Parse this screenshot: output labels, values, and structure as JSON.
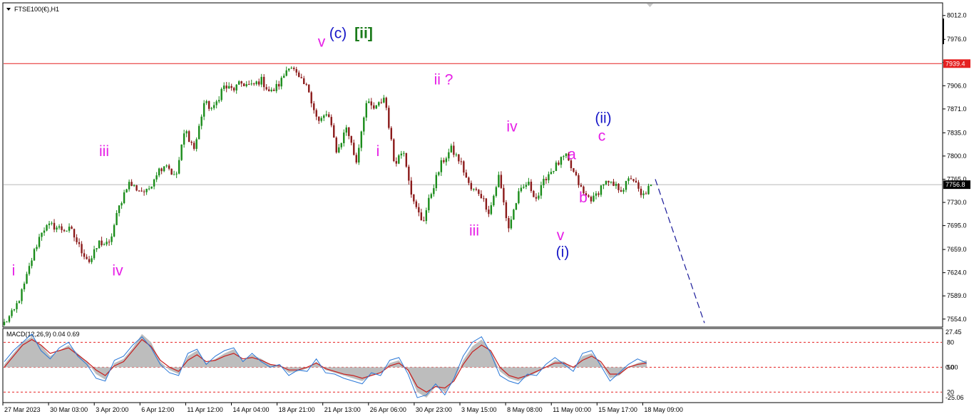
{
  "window": {
    "title": "FTSE100(€),H1"
  },
  "indicator": {
    "title": "MACD(12,26,9) 0.04 0.69"
  },
  "colors": {
    "background": "#ffffff",
    "bull": "#1a8c1a",
    "bear": "#8b1a1a",
    "resistance": "#e52020",
    "current_price_line": "#b8b8b8",
    "projection": "#1a1a9a",
    "macd_hist": "#bdbdbd",
    "macd_signal": "#c81e1e",
    "macd_line": "#2a78d8",
    "label_magenta": "#e61ee6",
    "label_blue": "#1818c8",
    "label_green": "#1a7a1a"
  },
  "chart_data": [
    {
      "type": "candlestick",
      "title": "FTSE100(€),H1",
      "ylim": [
        7543,
        8030
      ],
      "y_ticks": [
        "8012.0",
        "7976.0",
        "7941.0",
        "7906.0",
        "7871.0",
        "7835.0",
        "7800.0",
        "7765.0",
        "7730.0",
        "7695.0",
        "7659.0",
        "7624.0",
        "7589.0",
        "7554.0"
      ],
      "x_ticks": [
        "27 Mar 2023",
        "30 Mar 03:00",
        "3 Apr 20:00",
        "6 Apr 12:00",
        "11 Apr 12:00",
        "14 Apr 04:00",
        "18 Apr 21:00",
        "21 Apr 13:00",
        "26 Apr 06:00",
        "30 Apr 23:00",
        "3 May 15:00",
        "8 May 08:00",
        "11 May 00:00",
        "15 May 17:00",
        "18 May 09:00"
      ],
      "horizontal_lines": [
        {
          "name": "resistance",
          "price": 7939.4,
          "label": "7939.4",
          "color": "#e52020"
        },
        {
          "name": "current-price",
          "price": 7756.8,
          "label": "7756.8",
          "color": "#b8b8b8"
        }
      ],
      "price_path": [
        7548,
        7565,
        7600,
        7650,
        7690,
        7695,
        7690,
        7688,
        7660,
        7640,
        7670,
        7665,
        7720,
        7760,
        7750,
        7745,
        7775,
        7790,
        7765,
        7840,
        7810,
        7880,
        7870,
        7905,
        7900,
        7910,
        7905,
        7915,
        7895,
        7910,
        7940,
        7915,
        7900,
        7850,
        7865,
        7805,
        7845,
        7790,
        7880,
        7870,
        7890,
        7790,
        7810,
        7730,
        7700,
        7750,
        7790,
        7810,
        7790,
        7750,
        7745,
        7715,
        7770,
        7690,
        7740,
        7760,
        7735,
        7770,
        7785,
        7800,
        7770,
        7740,
        7735,
        7760,
        7755,
        7750,
        7770,
        7737,
        7756
      ],
      "projection": {
        "from_price": 7765,
        "to_price": 7548,
        "style": "dashed"
      },
      "wave_labels": [
        {
          "text": "i",
          "price": 7620,
          "color": "magenta"
        },
        {
          "text": "iii",
          "price": 7800,
          "color": "magenta"
        },
        {
          "text": "iv",
          "price": 7620,
          "color": "magenta"
        },
        {
          "text": "v",
          "price": 7965,
          "color": "magenta"
        },
        {
          "text": "(c)",
          "price": 7978,
          "color": "blue"
        },
        {
          "text": "[ii]",
          "price": 7978,
          "color": "green"
        },
        {
          "text": "i",
          "price": 7800,
          "color": "magenta"
        },
        {
          "text": "ii ?",
          "price": 7908,
          "color": "magenta"
        },
        {
          "text": "iii",
          "price": 7680,
          "color": "magenta"
        },
        {
          "text": "iv",
          "price": 7837,
          "color": "magenta"
        },
        {
          "text": "a",
          "price": 7795,
          "color": "magenta"
        },
        {
          "text": "b",
          "price": 7730,
          "color": "magenta"
        },
        {
          "text": "v",
          "price": 7673,
          "color": "magenta"
        },
        {
          "text": "(i)",
          "price": 7648,
          "color": "blue"
        },
        {
          "text": "(ii)",
          "price": 7850,
          "color": "blue"
        },
        {
          "text": "c",
          "price": 7823,
          "color": "magenta"
        }
      ]
    },
    {
      "type": "macd",
      "title": "MACD(12,26,9) 0.04 0.69",
      "parameters": [
        12,
        26,
        9
      ],
      "ylim": [
        -25.06,
        27.45
      ],
      "y_ticks": [
        "27.45",
        "0.00",
        "-25.06"
      ],
      "levels": [
        {
          "label": "80",
          "value": 18
        },
        {
          "label": "50",
          "value": 0
        },
        {
          "label": "20",
          "value": -18
        }
      ],
      "histogram": [
        2,
        10,
        18,
        22,
        16,
        8,
        12,
        16,
        10,
        4,
        -5,
        -9,
        3,
        6,
        14,
        24,
        18,
        4,
        -2,
        -5,
        8,
        12,
        3,
        6,
        10,
        13,
        5,
        9,
        6,
        2,
        1,
        -4,
        -3,
        -1,
        4,
        -2,
        -4,
        -6,
        -8,
        -10,
        -6,
        -4,
        3,
        5,
        -3,
        -18,
        -22,
        -14,
        -18,
        -10,
        5,
        15,
        20,
        12,
        -3,
        -8,
        -10,
        -7,
        -4,
        0,
        5,
        4,
        -1,
        8,
        10,
        3,
        -8,
        -6,
        0,
        3,
        5
      ],
      "signal": [
        0,
        8,
        16,
        20,
        16,
        10,
        12,
        14,
        9,
        4,
        -2,
        -6,
        1,
        4,
        12,
        20,
        15,
        5,
        0,
        -3,
        5,
        9,
        4,
        5,
        8,
        10,
        6,
        7,
        5,
        2,
        1,
        -2,
        -2,
        0,
        3,
        -1,
        -3,
        -5,
        -6,
        -8,
        -6,
        -4,
        1,
        3,
        -2,
        -14,
        -18,
        -14,
        -15,
        -10,
        2,
        11,
        16,
        12,
        0,
        -6,
        -8,
        -6,
        -3,
        0,
        3,
        3,
        0,
        5,
        8,
        4,
        -5,
        -5,
        0,
        2,
        3
      ],
      "macd": [
        4,
        12,
        18,
        24,
        12,
        6,
        14,
        18,
        8,
        2,
        -8,
        -10,
        5,
        8,
        16,
        22,
        14,
        2,
        -4,
        -6,
        10,
        13,
        2,
        8,
        12,
        14,
        4,
        10,
        4,
        0,
        2,
        -6,
        -2,
        -3,
        6,
        -4,
        -5,
        -8,
        -10,
        -12,
        -4,
        -6,
        5,
        7,
        -5,
        -22,
        -20,
        -12,
        -20,
        -8,
        8,
        18,
        22,
        10,
        -6,
        -10,
        -12,
        -5,
        -6,
        2,
        7,
        2,
        -3,
        10,
        12,
        1,
        -10,
        -4,
        2,
        6,
        3
      ]
    }
  ]
}
